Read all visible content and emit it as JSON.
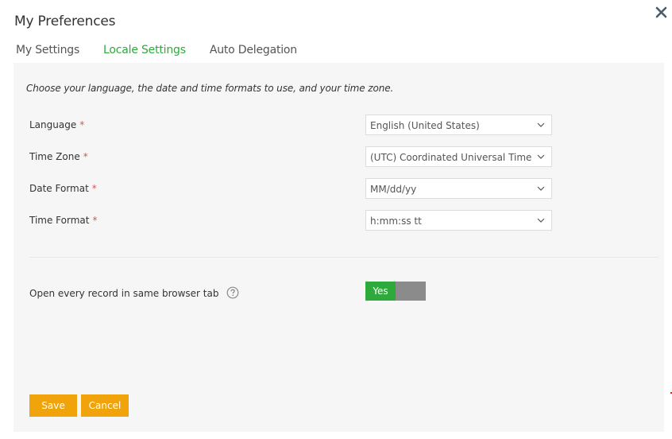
{
  "dialog": {
    "title": "My Preferences",
    "close_icon": "close-icon"
  },
  "tabs": [
    {
      "label": "My Settings",
      "active": false
    },
    {
      "label": "Locale Settings",
      "active": true
    },
    {
      "label": "Auto Delegation",
      "active": false
    }
  ],
  "locale": {
    "description": "Choose your language, the date and time formats to use, and your time zone.",
    "required_marker": "*",
    "fields": [
      {
        "label": "Language",
        "value": "English (United States)"
      },
      {
        "label": "Time Zone",
        "value": "(UTC) Coordinated Universal Time"
      },
      {
        "label": "Date Format",
        "value": "MM/dd/yy"
      },
      {
        "label": "Time Format",
        "value": "h:mm:ss tt"
      }
    ],
    "open_same_tab": {
      "label": "Open every record in same browser tab",
      "help_icon": "question-circle-icon",
      "toggle_on_label": "Yes",
      "value": true
    }
  },
  "actions": {
    "save_label": "Save",
    "cancel_label": "Cancel"
  },
  "colors": {
    "accent_green": "#2eaa3c",
    "button_orange": "#f0a30a",
    "required_red": "#e05050",
    "toggle_off_gray": "#8b8b8b",
    "panel_bg": "#f6f6f6"
  }
}
